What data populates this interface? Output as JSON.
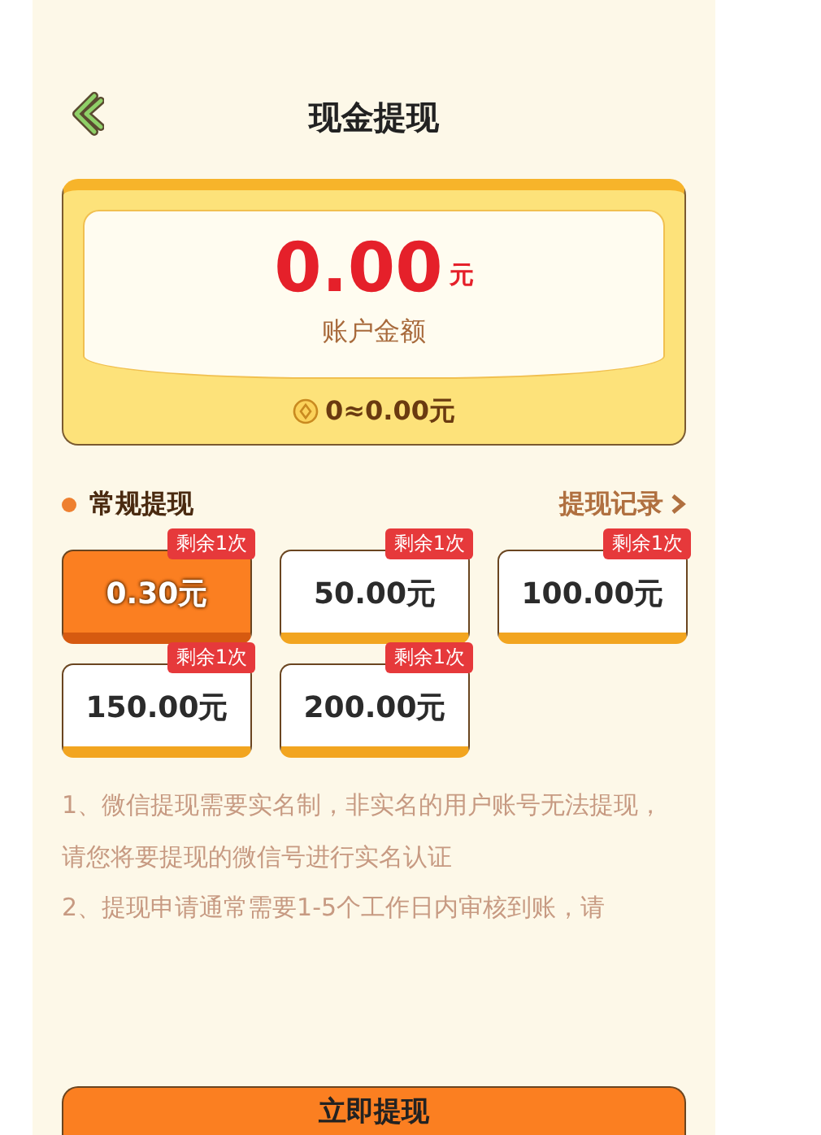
{
  "header": {
    "title": "现金提现"
  },
  "balance": {
    "amount": "0.00",
    "unit": "元",
    "label": "账户金额",
    "coins": "0≈0.00元"
  },
  "section": {
    "title": "常规提现",
    "link": "提现记录"
  },
  "options": [
    {
      "amount": "0.30元",
      "tag": "剩余1次",
      "selected": true
    },
    {
      "amount": "50.00元",
      "tag": "剩余1次",
      "selected": false
    },
    {
      "amount": "100.00元",
      "tag": "剩余1次",
      "selected": false
    },
    {
      "amount": "150.00元",
      "tag": "剩余1次",
      "selected": false
    },
    {
      "amount": "200.00元",
      "tag": "剩余1次",
      "selected": false
    }
  ],
  "notes": [
    "1、微信提现需要实名制，非实名的用户账号无法提现，请您将要提现的微信号进行实名认证",
    "2、提现申请通常需要1-5个工作日内审核到账，请"
  ],
  "submit_button": "立即提现"
}
